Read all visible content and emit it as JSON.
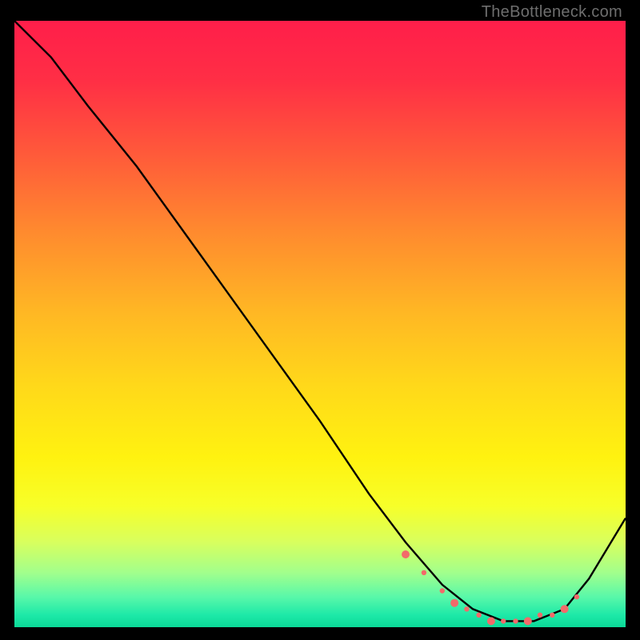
{
  "watermark": "TheBottleneck.com",
  "chart_data": {
    "type": "line",
    "title": "",
    "xlabel": "",
    "ylabel": "",
    "xlim": [
      0,
      100
    ],
    "ylim": [
      0,
      100
    ],
    "series": [
      {
        "name": "bottleneck-curve",
        "x": [
          0,
          6,
          12,
          20,
          30,
          40,
          50,
          58,
          64,
          70,
          75,
          80,
          85,
          90,
          94,
          100
        ],
        "y": [
          100,
          94,
          86,
          76,
          62,
          48,
          34,
          22,
          14,
          7,
          3,
          1,
          1,
          3,
          8,
          18
        ]
      }
    ],
    "markers": {
      "name": "sample-points",
      "color": "#f26a6a",
      "x": [
        64,
        67,
        70,
        72,
        74,
        76,
        78,
        80,
        82,
        84,
        86,
        88,
        90,
        92
      ],
      "y": [
        12,
        9,
        6,
        4,
        3,
        2,
        1,
        1,
        1,
        1,
        2,
        2,
        3,
        5
      ]
    },
    "gradient_stops": [
      {
        "pct": 0,
        "color": "#ff1e4a"
      },
      {
        "pct": 22,
        "color": "#ff5a3a"
      },
      {
        "pct": 48,
        "color": "#ffb724"
      },
      {
        "pct": 72,
        "color": "#fff210"
      },
      {
        "pct": 91,
        "color": "#a2ff8c"
      },
      {
        "pct": 100,
        "color": "#0bd997"
      }
    ]
  }
}
